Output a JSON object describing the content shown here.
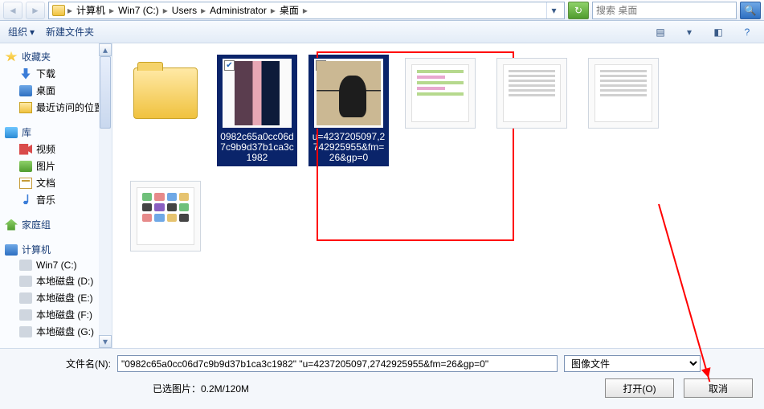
{
  "breadcrumb": [
    "计算机",
    "Win7 (C:)",
    "Users",
    "Administrator",
    "桌面"
  ],
  "search_placeholder": "搜索 桌面",
  "toolbar": {
    "organize": "组织",
    "newfolder": "新建文件夹"
  },
  "tree": {
    "fav": {
      "title": "收藏夹",
      "items": [
        "下载",
        "桌面",
        "最近访问的位置"
      ]
    },
    "lib": {
      "title": "库",
      "items": [
        "视频",
        "图片",
        "文档",
        "音乐"
      ]
    },
    "home": {
      "title": "家庭组"
    },
    "pc": {
      "title": "计算机",
      "items": [
        "Win7 (C:)",
        "本地磁盘 (D:)",
        "本地磁盘 (E:)",
        "本地磁盘 (F:)",
        "本地磁盘 (G:)"
      ]
    }
  },
  "files": [
    {
      "type": "folder",
      "name": ""
    },
    {
      "type": "image",
      "name": "0982c65a0cc06d7c9b9d37b1ca3c1982",
      "selected": true,
      "check": "✔"
    },
    {
      "type": "image",
      "name": "u=4237205097,2742925955&fm=26&gp=0",
      "selected": true,
      "check": "✔"
    },
    {
      "type": "doc",
      "name": ""
    },
    {
      "type": "doc",
      "name": ""
    },
    {
      "type": "doc",
      "name": ""
    },
    {
      "type": "doc",
      "name": ""
    }
  ],
  "bottom": {
    "filename_label": "文件名(N):",
    "filename_value": "\"0982c65a0cc06d7c9b9d37b1ca3c1982\" \"u=4237205097,2742925955&fm=26&gp=0\"",
    "filetype": "图像文件",
    "status": "已选图片：0.2M/120M",
    "open": "打开(O)",
    "cancel": "取消"
  }
}
